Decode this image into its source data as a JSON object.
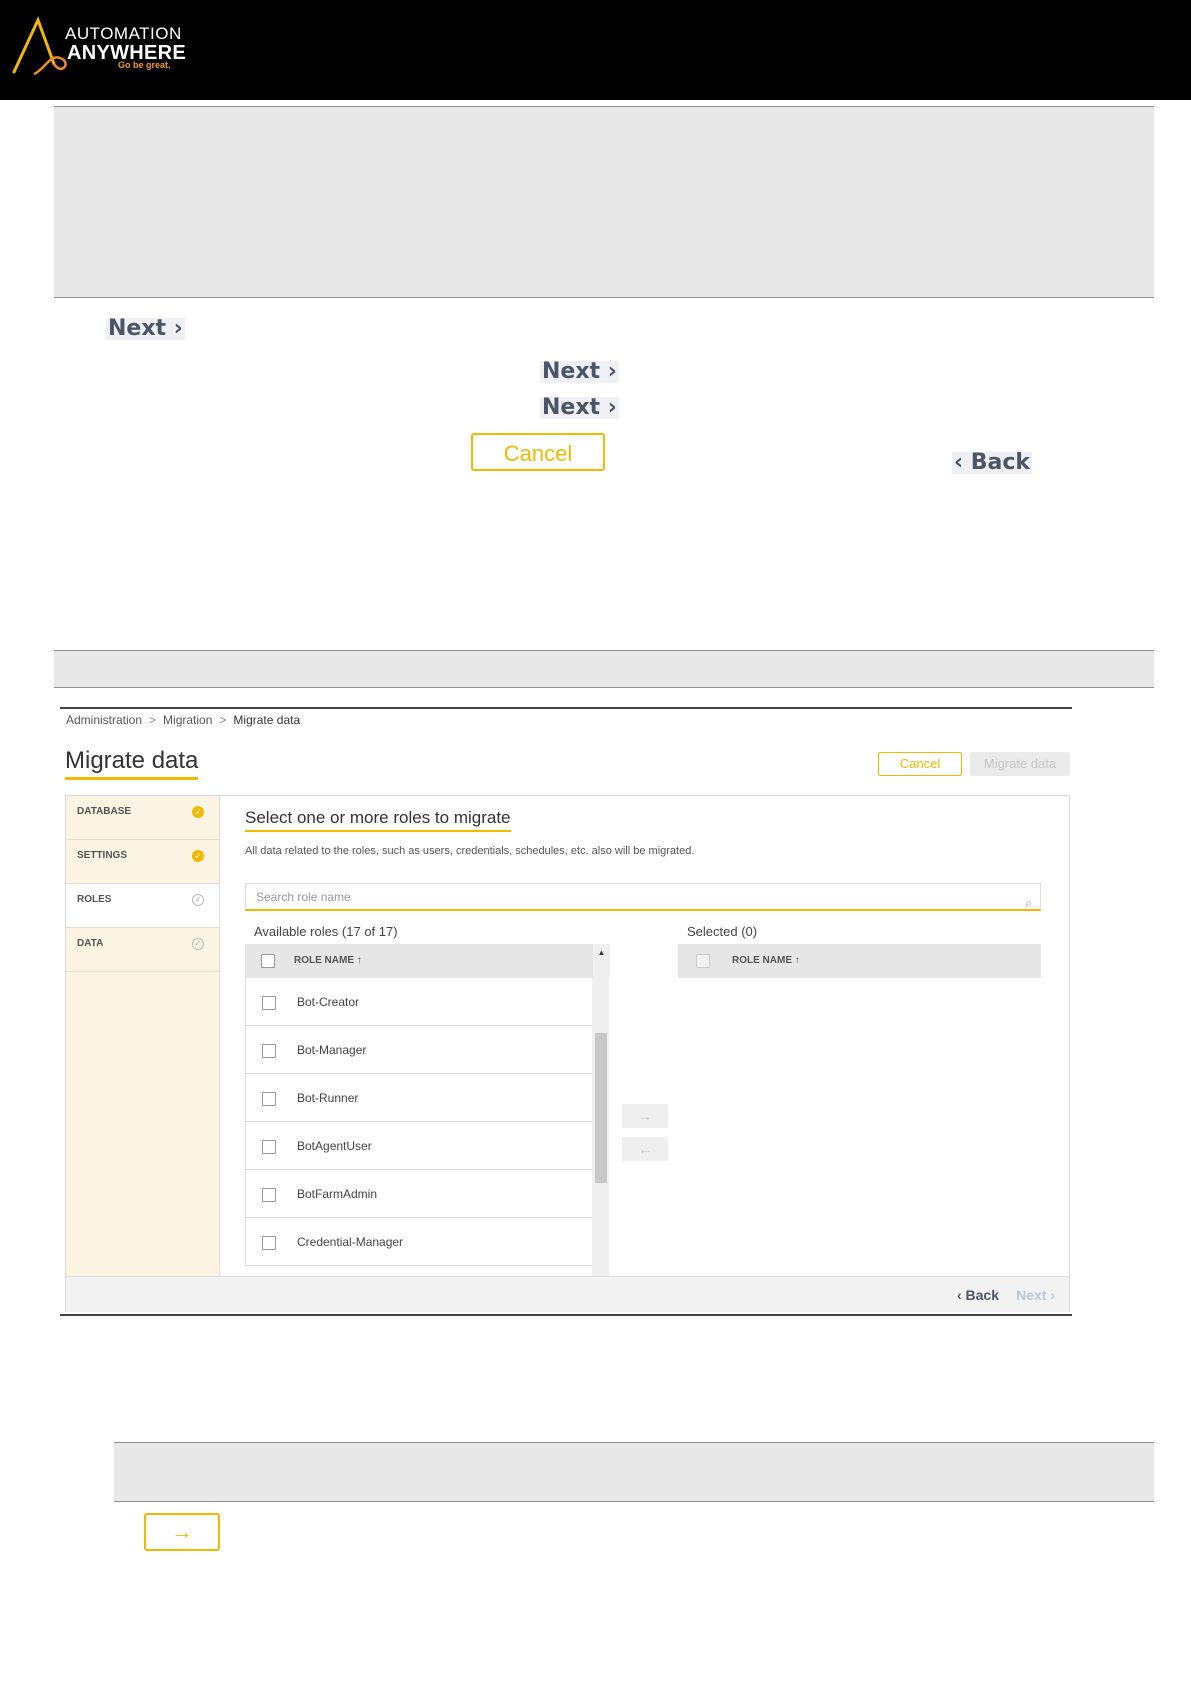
{
  "header": {
    "brand_line1": "AUTOMATION",
    "brand_line2": "ANYWHERE",
    "tagline": "Go be great.",
    "accent": "#f5b800"
  },
  "callouts": {
    "next_1": "Next",
    "next_2": "Next",
    "next_3": "Next",
    "cancel": "Cancel",
    "back": "Back",
    "arrow_button": "→"
  },
  "screenshot": {
    "breadcrumb": [
      "Administration",
      "Migration",
      "Migrate data"
    ],
    "breadcrumb_sep": ">",
    "title": "Migrate data",
    "cancel_label": "Cancel",
    "migrate_label": "Migrate data",
    "steps": [
      {
        "label": "DATABASE",
        "status": "done"
      },
      {
        "label": "SETTINGS",
        "status": "done"
      },
      {
        "label": "ROLES",
        "status": "current"
      },
      {
        "label": "DATA",
        "status": "pending"
      }
    ],
    "section_title": "Select one or more roles to migrate",
    "section_desc": "All data related to the roles, such as users, credentials, schedules, etc. also will be migrated.",
    "search_placeholder": "Search role name",
    "available_label": "Available roles (17 of 17)",
    "selected_label": "Selected (0)",
    "column_header": "ROLE NAME ↑",
    "roles": [
      "Bot-Creator",
      "Bot-Manager",
      "Bot-Runner",
      "BotAgentUser",
      "BotFarmAdmin",
      "Credential-Manager"
    ],
    "move_right": "→",
    "move_left": "←",
    "footer_back": "Back",
    "footer_next": "Next"
  }
}
